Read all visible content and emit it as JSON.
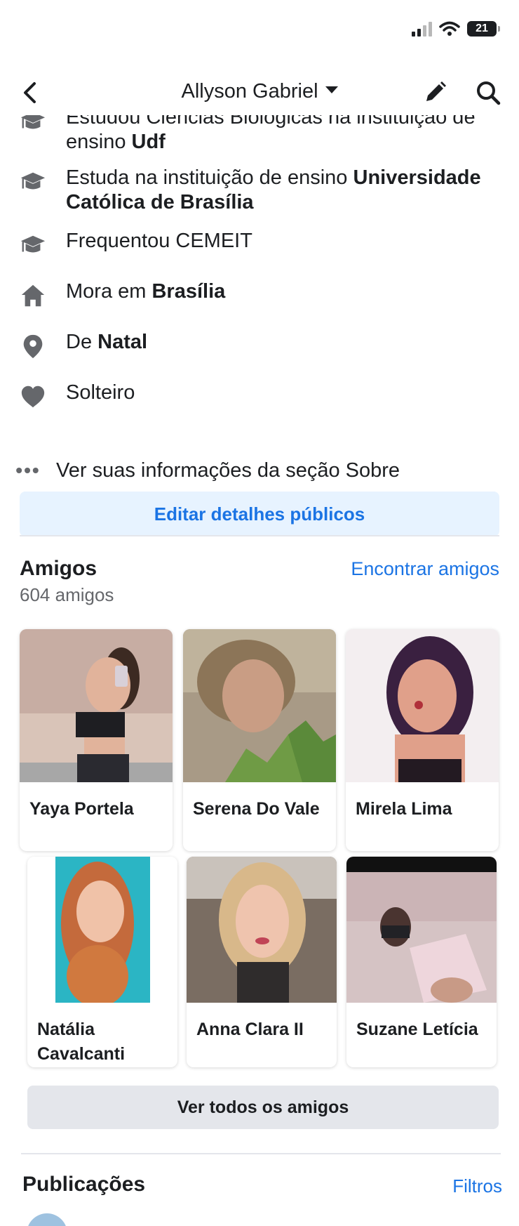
{
  "status_bar": {
    "battery": "21"
  },
  "header": {
    "title": "Allyson Gabriel"
  },
  "intro": {
    "items": [
      {
        "icon": "graduation-cap-icon",
        "text": "Estudou Ciências Biológicas na instituição de ensino ",
        "bold": "Udf"
      },
      {
        "icon": "graduation-cap-icon",
        "text": "Estuda na instituição de ensino ",
        "bold": "Universidade Católica de Brasília"
      },
      {
        "icon": "graduation-cap-icon",
        "text": "Frequentou CEMEIT",
        "bold": ""
      },
      {
        "icon": "home-icon",
        "text": "Mora em ",
        "bold": "Brasília"
      },
      {
        "icon": "location-pin-icon",
        "text": "De ",
        "bold": "Natal"
      },
      {
        "icon": "heart-icon",
        "text": "Solteiro",
        "bold": ""
      }
    ],
    "see_more": "Ver suas informações da seção Sobre",
    "edit_button": "Editar detalhes públicos"
  },
  "friends": {
    "title": "Amigos",
    "find_link": "Encontrar amigos",
    "count": "604 amigos",
    "list": [
      {
        "name": "Yaya Portela"
      },
      {
        "name": "Serena Do Vale"
      },
      {
        "name": "Mirela Lima"
      },
      {
        "name": "Natália Cavalcanti"
      },
      {
        "name": "Anna Clara II"
      },
      {
        "name": "Suzane Letícia"
      }
    ],
    "see_all": "Ver todos os amigos"
  },
  "posts": {
    "title": "Publicações",
    "filters": "Filtros"
  }
}
